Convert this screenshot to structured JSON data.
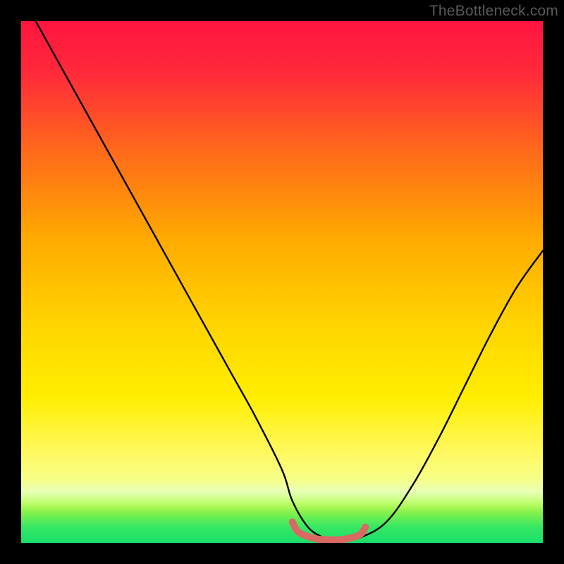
{
  "watermark": {
    "text": "TheBottleneck.com"
  },
  "colors": {
    "gradient_top": "#ff1744",
    "gradient_mid_upper": "#ff8a00",
    "gradient_mid": "#ffe600",
    "gradient_mid_lower": "#f7ff66",
    "gradient_green_start": "#c6ff3d",
    "gradient_green_end": "#18e06a",
    "curve": "#000000",
    "accent_stroke": "#d86a63",
    "frame": "#000000"
  },
  "chart_data": {
    "type": "line",
    "title": "",
    "xlabel": "",
    "ylabel": "",
    "xlim": [
      0,
      100
    ],
    "ylim": [
      0,
      100
    ],
    "series": [
      {
        "name": "bottleneck-curve",
        "x": [
          0,
          5,
          10,
          15,
          20,
          25,
          30,
          35,
          40,
          45,
          50,
          52,
          55,
          58,
          60,
          62,
          65,
          70,
          75,
          80,
          85,
          90,
          95,
          100
        ],
        "y": [
          105,
          96,
          87,
          78,
          69,
          60,
          51,
          42,
          33,
          24,
          14,
          8,
          3,
          1,
          0.5,
          0.5,
          1,
          4,
          11,
          20,
          30,
          40,
          49,
          56
        ]
      },
      {
        "name": "optimal-zone-accent",
        "x": [
          52,
          53,
          55,
          57,
          59,
          61,
          63,
          65,
          66
        ],
        "y": [
          4,
          2.2,
          1.2,
          0.7,
          0.6,
          0.6,
          0.9,
          1.6,
          3.0
        ]
      }
    ],
    "annotations": []
  }
}
